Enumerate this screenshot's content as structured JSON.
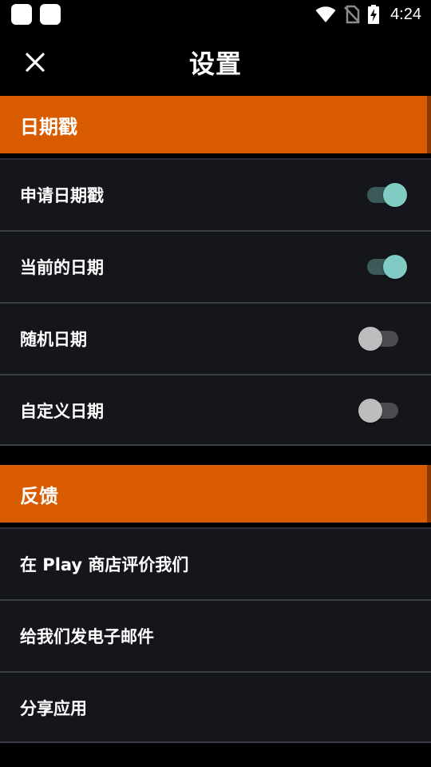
{
  "status_bar": {
    "time": "4:24",
    "icons": [
      "app-notification-icon",
      "app-notification-icon",
      "wifi-icon",
      "no-sim-icon",
      "battery-charging-icon"
    ]
  },
  "app_bar": {
    "title": "设置",
    "close_icon": "close-icon"
  },
  "sections": {
    "date_stamp": {
      "header": "日期戳",
      "items": [
        {
          "label": "申请日期戳",
          "toggle": true
        },
        {
          "label": "当前的日期",
          "toggle": true
        },
        {
          "label": "随机日期",
          "toggle": false
        },
        {
          "label": "自定义日期",
          "toggle": false
        }
      ]
    },
    "feedback": {
      "header": "反馈",
      "items": [
        {
          "label": "在 Play 商店评价我们"
        },
        {
          "label": "给我们发电子邮件"
        },
        {
          "label": "分享应用"
        }
      ]
    }
  },
  "colors": {
    "accent": "#d95b00",
    "toggle_on_thumb": "#80cbc4",
    "toggle_off_thumb": "#bdbdbd",
    "row_background": "#14161c"
  }
}
